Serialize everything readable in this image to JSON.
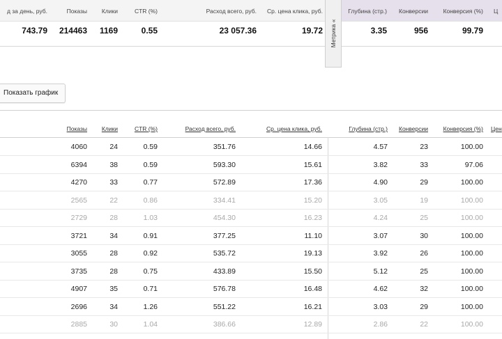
{
  "summary": {
    "headers": {
      "daily_spend": "д за день, руб.",
      "impressions": "Показы",
      "clicks": "Клики",
      "ctr": "CTR (%)",
      "total_spend": "Расход всего, руб.",
      "avg_cpc": "Ср. цена клика, руб.",
      "depth": "Глубина (стр.)",
      "conversions": "Конверсии",
      "conversion_rate": "Конверсия (%)",
      "partial": "Ц"
    },
    "values": {
      "daily_spend": "743.79",
      "impressions": "214463",
      "clicks": "1169",
      "ctr": "0.55",
      "total_spend": "23 057.36",
      "avg_cpc": "19.72",
      "depth": "3.35",
      "conversions": "956",
      "conversion_rate": "99.79"
    },
    "metrika_tab": "Метрика «"
  },
  "show_chart_button": "Показать график",
  "detail": {
    "headers": {
      "impressions": "Показы",
      "clicks": "Клики",
      "ctr": "CTR (%)",
      "total_spend": "Расход всего, руб.",
      "avg_cpc": "Ср. цена клика, руб.",
      "depth": "Глубина (стр.)",
      "conversions": "Конверсии",
      "conversion_rate": "Конверсия (%)",
      "partial": "Цен"
    },
    "rows": [
      {
        "impressions": "4060",
        "clicks": "24",
        "ctr": "0.59",
        "total_spend": "351.76",
        "avg_cpc": "14.66",
        "depth": "4.57",
        "conversions": "23",
        "conversion_rate": "100.00",
        "dimmed": false
      },
      {
        "impressions": "6394",
        "clicks": "38",
        "ctr": "0.59",
        "total_spend": "593.30",
        "avg_cpc": "15.61",
        "depth": "3.82",
        "conversions": "33",
        "conversion_rate": "97.06",
        "dimmed": false
      },
      {
        "impressions": "4270",
        "clicks": "33",
        "ctr": "0.77",
        "total_spend": "572.89",
        "avg_cpc": "17.36",
        "depth": "4.90",
        "conversions": "29",
        "conversion_rate": "100.00",
        "dimmed": false
      },
      {
        "impressions": "2565",
        "clicks": "22",
        "ctr": "0.86",
        "total_spend": "334.41",
        "avg_cpc": "15.20",
        "depth": "3.05",
        "conversions": "19",
        "conversion_rate": "100.00",
        "dimmed": true
      },
      {
        "impressions": "2729",
        "clicks": "28",
        "ctr": "1.03",
        "total_spend": "454.30",
        "avg_cpc": "16.23",
        "depth": "4.24",
        "conversions": "25",
        "conversion_rate": "100.00",
        "dimmed": true
      },
      {
        "impressions": "3721",
        "clicks": "34",
        "ctr": "0.91",
        "total_spend": "377.25",
        "avg_cpc": "11.10",
        "depth": "3.07",
        "conversions": "30",
        "conversion_rate": "100.00",
        "dimmed": false
      },
      {
        "impressions": "3055",
        "clicks": "28",
        "ctr": "0.92",
        "total_spend": "535.72",
        "avg_cpc": "19.13",
        "depth": "3.92",
        "conversions": "26",
        "conversion_rate": "100.00",
        "dimmed": false
      },
      {
        "impressions": "3735",
        "clicks": "28",
        "ctr": "0.75",
        "total_spend": "433.89",
        "avg_cpc": "15.50",
        "depth": "5.12",
        "conversions": "25",
        "conversion_rate": "100.00",
        "dimmed": false
      },
      {
        "impressions": "4907",
        "clicks": "35",
        "ctr": "0.71",
        "total_spend": "576.78",
        "avg_cpc": "16.48",
        "depth": "4.62",
        "conversions": "32",
        "conversion_rate": "100.00",
        "dimmed": false
      },
      {
        "impressions": "2696",
        "clicks": "34",
        "ctr": "1.26",
        "total_spend": "551.22",
        "avg_cpc": "16.21",
        "depth": "3.03",
        "conversions": "29",
        "conversion_rate": "100.00",
        "dimmed": false
      },
      {
        "impressions": "2885",
        "clicks": "30",
        "ctr": "1.04",
        "total_spend": "386.66",
        "avg_cpc": "12.89",
        "depth": "2.86",
        "conversions": "22",
        "conversion_rate": "100.00",
        "dimmed": true
      }
    ]
  },
  "colors": {
    "metrika_header_bg": "#e6e0ec",
    "dimmed_text": "#a8a8a8"
  }
}
